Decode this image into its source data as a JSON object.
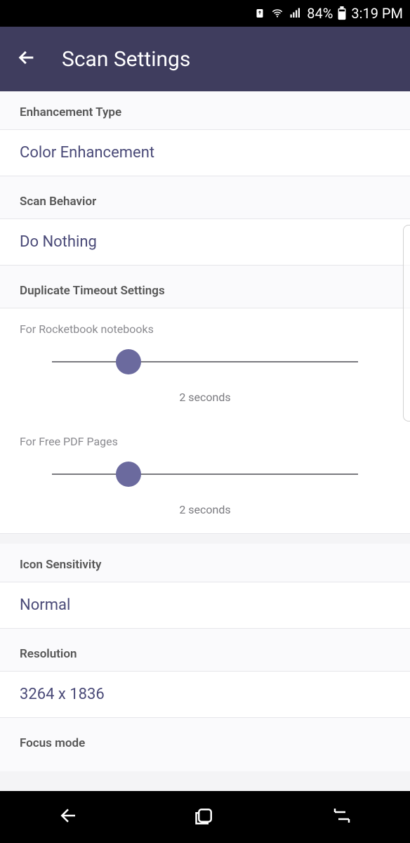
{
  "status": {
    "battery_pct": "84%",
    "time": "3:19 PM"
  },
  "header": {
    "title": "Scan Settings"
  },
  "settings": {
    "enhancement": {
      "label": "Enhancement Type",
      "value": "Color Enhancement"
    },
    "scan_behavior": {
      "label": "Scan Behavior",
      "value": "Do Nothing"
    },
    "duplicate_timeout": {
      "label": "Duplicate Timeout Settings",
      "rocketbook": {
        "label": "For Rocketbook notebooks",
        "value_text": "2 seconds",
        "value_seconds": 2,
        "slider_percent": 25
      },
      "free_pdf": {
        "label": "For Free PDF Pages",
        "value_text": "2 seconds",
        "value_seconds": 2,
        "slider_percent": 25
      }
    },
    "icon_sensitivity": {
      "label": "Icon Sensitivity",
      "value": "Normal"
    },
    "resolution": {
      "label": "Resolution",
      "value": "3264 x 1836"
    },
    "focus_mode": {
      "label": "Focus mode"
    }
  }
}
